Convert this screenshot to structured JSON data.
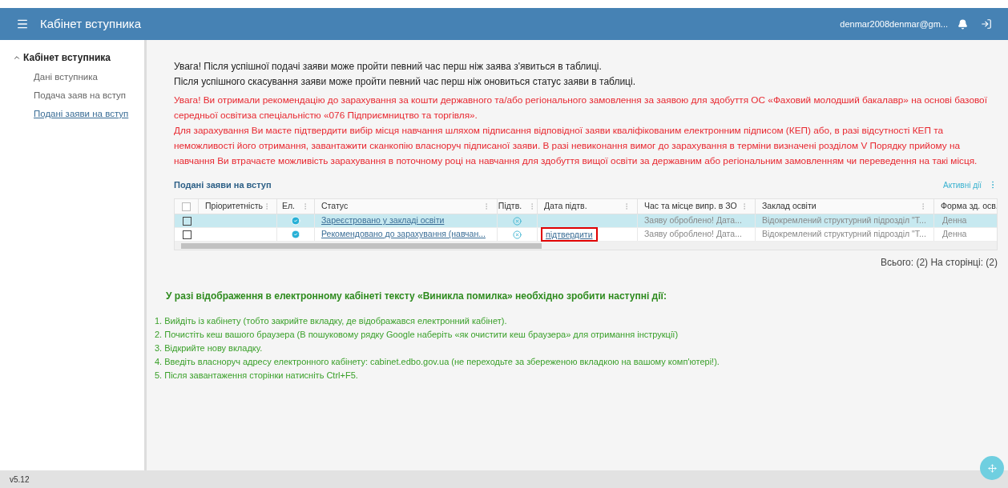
{
  "header": {
    "title": "Кабінет вступника",
    "user": "denmar2008denmar@gm..."
  },
  "sidebar": {
    "section": {
      "label": "Кабінет вступника",
      "expanded": true
    },
    "items": [
      {
        "label": "Дані вступника",
        "selected": false
      },
      {
        "label": "Подача заяв на вступ",
        "selected": false
      },
      {
        "label": "Подані заяви на вступ",
        "selected": true
      }
    ]
  },
  "notices": [
    "Увага! Після успішної подачі заяви може пройти певний час перш ніж заява з'явиться в таблиці.",
    "Після успішного скасування заяви може пройти певний час перш ніж оновиться статус заяви в таблиці."
  ],
  "warning": [
    "Увага! Ви отримали рекомендацію до зарахування за кошти державного та/або регіонального замовлення за заявою для здобуття ОС «Фаховий молодший бакалавр» на основі базової середньої освітиза спеціальністю «076 Підприємництво та торгівля».",
    "Для зарахування Ви маєте підтвердити вибір місця навчання шляхом підписання відповідної заяви кваліфікованим електронним підписом (КЕП) або, в разі відсутності КЕП та неможливості його отримання, завантажити сканкопію власноруч підписаної заяви. В разі невиконання вимог до зарахування в терміни визначені розділом V Порядку прийому на навчання Ви втрачаєте можливість зарахування в поточному році на навчання для здобуття вищої освіти за державним або регіональним замовленням чи переведення на такі місця."
  ],
  "table": {
    "title": "Подані заяви на вступ",
    "actions": "Активні дії",
    "all_checked": false,
    "columns": [
      "Пріоритетність",
      "Ел.",
      "Статус",
      "Підтв.",
      "Дата підтв.",
      "Час та місце випр. в ЗО",
      "Заклад освіти",
      "Форма зд. осв."
    ],
    "rows": [
      {
        "selected": true,
        "checked": false,
        "electronic": true,
        "status": "Зареєстровано у закладі освіти",
        "confirmed": false,
        "confirm_link": null,
        "time_place": "Заяву оброблено! Дата...",
        "institution": "Відокремлений структурний підрозділ \"Т...",
        "form": "Денна"
      },
      {
        "selected": false,
        "checked": false,
        "electronic": true,
        "status": "Рекомендовано до зарахування (навчан...",
        "confirmed": false,
        "confirm_link": {
          "label": "підтвердити",
          "marked": true
        },
        "time_place": "Заяву оброблено! Дата...",
        "institution": "Відокремлений структурний підрозділ \"Т...",
        "form": "Денна"
      }
    ],
    "summary": "Всього: (2) На сторінці: (2)"
  },
  "help": {
    "heading": "У разі відображення в електронному кабінеті тексту «Виникла помилка» необхідно зробити наступні дії:",
    "steps": [
      "1. Вийдіть із кабінету (тобто закрийте вкладку, де відображався електронний кабінет).",
      "2. Почистіть кеш вашого браузера (В пошуковому рядку Google наберіть «як очистити кеш браузера» для отримання інструкції)",
      "3. Відкрийте нову вкладку.",
      "4. Введіть власноруч адресу електронного кабінету: cabinet.edbo.gov.ua (не переходьте за збереженою вкладкою на вашому комп'ютері!).",
      "5. Після завантаження сторінки натисніть Ctrl+F5."
    ]
  },
  "footer": {
    "version": "v5.12"
  }
}
